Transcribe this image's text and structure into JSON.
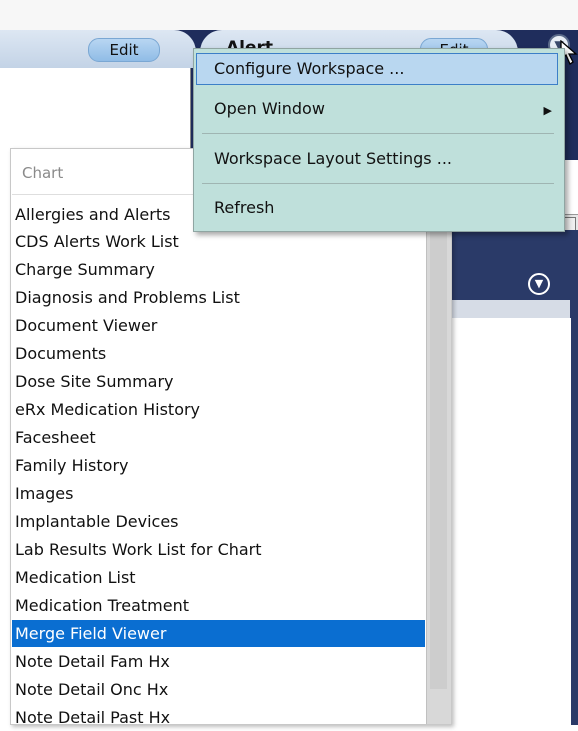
{
  "workspace": {
    "left_tab": {
      "edit_label": "Edit"
    },
    "right_tab": {
      "title": "Alert",
      "edit_label": "Edit"
    }
  },
  "context_menu": {
    "items": [
      {
        "label": "Configure Workspace ...",
        "highlighted": true
      },
      {
        "label": "Open Window",
        "submenu": true
      },
      {
        "label": "Workspace Layout Settings ..."
      },
      {
        "label": "Refresh"
      }
    ]
  },
  "chart_list": {
    "header": "Chart",
    "items": [
      "Allergies and Alerts",
      "CDS Alerts Work List",
      "Charge Summary",
      "Diagnosis and Problems List",
      "Document Viewer",
      "Documents",
      "Dose Site Summary",
      "eRx Medication History",
      "Facesheet",
      "Family History",
      "Images",
      "Implantable Devices",
      "Lab Results Work List for Chart",
      "Medication List",
      "Medication Treatment",
      "Merge Field Viewer",
      "Note Detail Fam Hx",
      "Note Detail Onc Hx",
      "Note Detail Past Hx"
    ],
    "selected_index": 15
  },
  "right_panel": {
    "tab_fragment": "abs"
  },
  "colors": {
    "navy": "#1f2d5c",
    "menu_bg": "#bfe0db",
    "selection": "#0a6ed1"
  }
}
